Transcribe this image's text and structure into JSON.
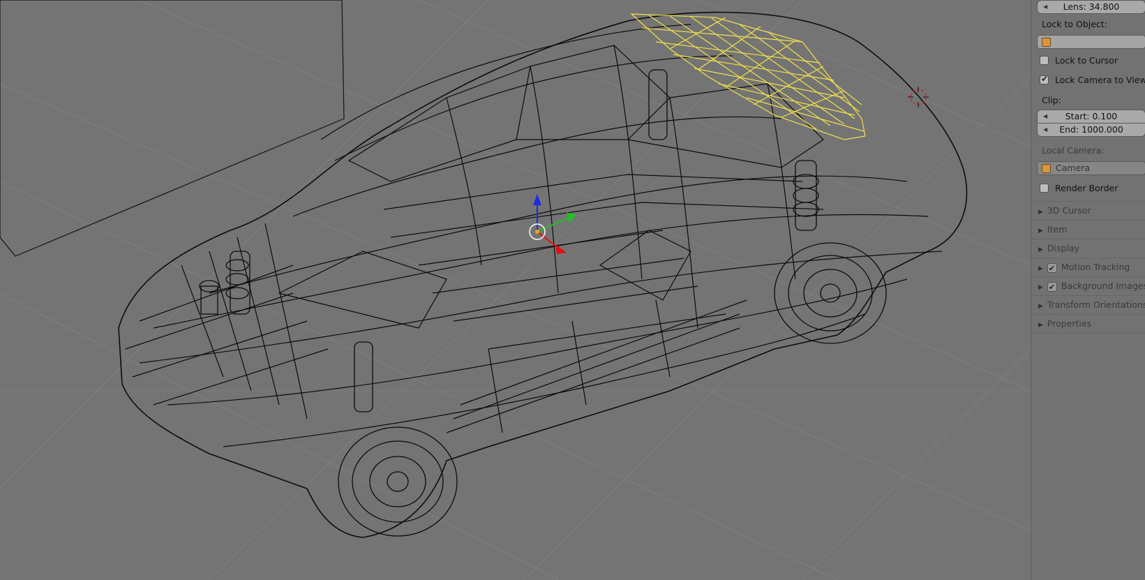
{
  "panel": {
    "lens_label": "Lens: 34.800",
    "lock_to_object_label": "Lock to Object:",
    "lock_to_cursor": {
      "label": "Lock to Cursor",
      "checked": false
    },
    "lock_camera_to_view": {
      "label": "Lock Camera to View",
      "checked": true
    },
    "clip_label": "Clip:",
    "clip_start": "Start: 0.100",
    "clip_end": "End: 1000.000",
    "local_camera_label": "Local Camera:",
    "local_camera_value": "Camera",
    "render_border": {
      "label": "Render Border",
      "checked": false
    },
    "sections": [
      {
        "label": "3D Cursor",
        "has_checkbox": false
      },
      {
        "label": "Item",
        "has_checkbox": false
      },
      {
        "label": "Display",
        "has_checkbox": false
      },
      {
        "label": "Motion Tracking",
        "has_checkbox": true,
        "checked": true
      },
      {
        "label": "Background Images",
        "has_checkbox": true,
        "checked": true
      },
      {
        "label": "Transform Orientations",
        "has_checkbox": false
      },
      {
        "label": "Properties",
        "has_checkbox": false
      }
    ]
  },
  "viewport": {
    "object": "car-wireframe",
    "selected_element": "roof-mesh",
    "colors": {
      "background": "#747474",
      "wireframe": "#0b0b0b",
      "selection": "#f2e14a",
      "axis_x": "#e01010",
      "axis_y": "#22c022",
      "axis_z": "#1a2ee0",
      "cursor": "#cc2222"
    }
  }
}
